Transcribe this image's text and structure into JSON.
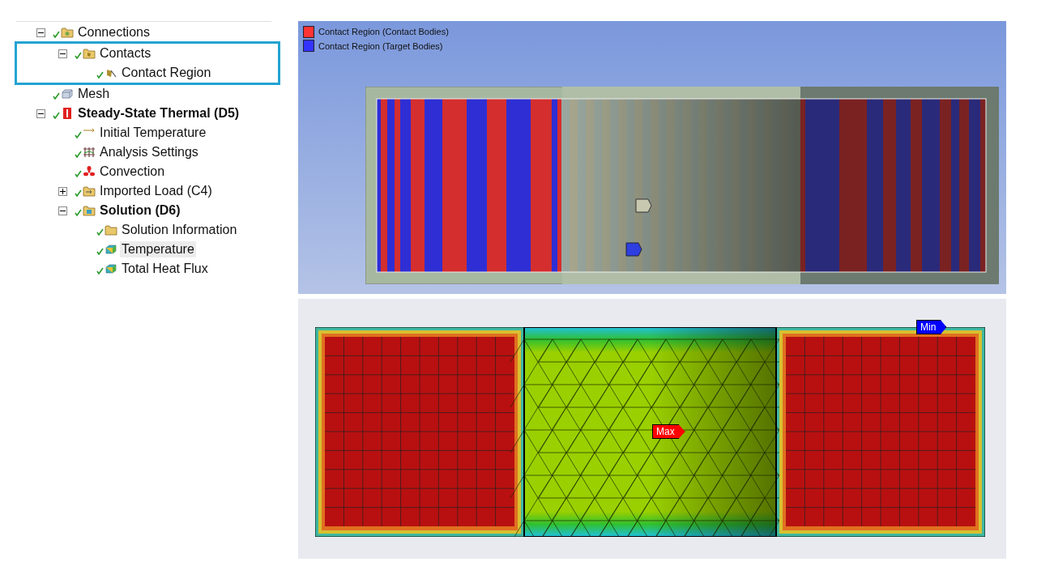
{
  "tree": [
    {
      "label": "Connections",
      "kind": "connections",
      "bold": false,
      "selected": false,
      "expanded": true,
      "outlined": false,
      "children": [
        {
          "label": "Contacts",
          "kind": "contacts",
          "bold": false,
          "selected": false,
          "expanded": true,
          "outlined": true,
          "children": [
            {
              "label": "Contact Region",
              "kind": "contact-region",
              "bold": false,
              "selected": false,
              "outlined": false
            }
          ]
        }
      ]
    },
    {
      "label": "Mesh",
      "kind": "mesh",
      "bold": false,
      "selected": false,
      "outlined": false
    },
    {
      "label": "Steady-State Thermal (D5)",
      "kind": "analysis",
      "bold": true,
      "selected": false,
      "expanded": true,
      "outlined": false,
      "children": [
        {
          "label": "Initial Temperature",
          "kind": "initial-temperature",
          "bold": false,
          "selected": false,
          "outlined": false
        },
        {
          "label": "Analysis Settings",
          "kind": "settings",
          "bold": false,
          "selected": false,
          "outlined": false
        },
        {
          "label": "Convection",
          "kind": "convection",
          "bold": false,
          "selected": false,
          "outlined": false
        },
        {
          "label": "Imported Load (C4)",
          "kind": "load",
          "bold": false,
          "selected": false,
          "expanded": false,
          "outlined": false
        },
        {
          "label": "Solution (D6)",
          "kind": "solution",
          "bold": true,
          "selected": false,
          "expanded": true,
          "outlined": false,
          "children": [
            {
              "label": "Solution Information",
              "kind": "information",
              "bold": false,
              "selected": false,
              "outlined": false
            },
            {
              "label": "Temperature",
              "kind": "result",
              "bold": false,
              "selected": true,
              "outlined": false
            },
            {
              "label": "Total Heat Flux",
              "kind": "result",
              "bold": false,
              "selected": false,
              "outlined": false
            }
          ]
        }
      ]
    }
  ],
  "contact_view": {
    "legend": [
      {
        "label": "Contact Region (Contact Bodies)",
        "color": "#ff3333"
      },
      {
        "label": "Contact Region (Target Bodies)",
        "color": "#3333ff"
      }
    ]
  },
  "result_view": {
    "probes": [
      {
        "text": "Max",
        "kind": "max",
        "color": "#ff0000"
      },
      {
        "text": "Min",
        "kind": "min",
        "color": "#0000ff"
      }
    ]
  }
}
